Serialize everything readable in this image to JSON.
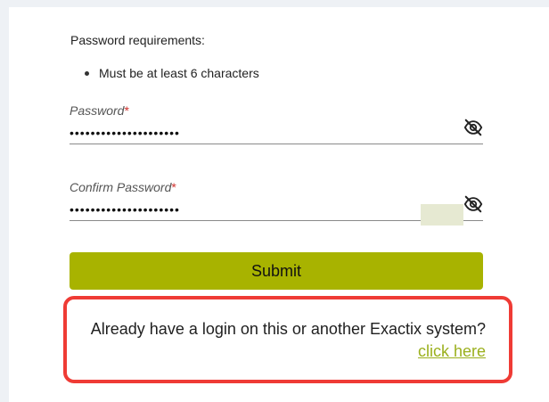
{
  "requirements": {
    "heading": "Password requirements:",
    "items": [
      "Must be at least 6 characters"
    ]
  },
  "password_field": {
    "label": "Password",
    "required_marker": "*",
    "value": "•••••••••••••••••••••",
    "visibility_icon": "eye-slash-icon"
  },
  "confirm_password_field": {
    "label": "Confirm Password",
    "required_marker": "*",
    "value": "•••••••••••••••••••••",
    "visibility_icon": "eye-slash-icon"
  },
  "submit": {
    "label": "Submit",
    "color": "#a8b300"
  },
  "login_prompt": {
    "text": "Already have a login on this or another Exactix system?",
    "link_text": "click here",
    "highlight_color": "#ef3b35",
    "link_color": "#9bb01d"
  }
}
